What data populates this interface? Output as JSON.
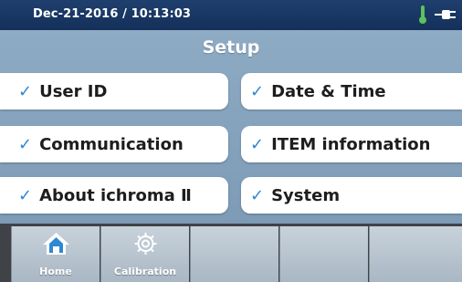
{
  "status_bar": {
    "datetime": "Dec-21-2016 / 10:13:03",
    "thermometer_color": "#5fc15a",
    "icons": [
      "thermometer-icon",
      "power-plug-icon"
    ]
  },
  "title": "Setup",
  "menu": {
    "check_mark": "✓",
    "items": [
      {
        "label": "User ID"
      },
      {
        "label": "Date & Time"
      },
      {
        "label": "Communication"
      },
      {
        "label": "ITEM information"
      },
      {
        "label": "About ichroma Ⅱ"
      },
      {
        "label": "System"
      }
    ]
  },
  "nav": {
    "tabs": [
      {
        "label": "Home",
        "icon": "home-icon"
      },
      {
        "label": "Calibration",
        "icon": "gear-icon"
      },
      {
        "label": ""
      },
      {
        "label": ""
      },
      {
        "label": ""
      }
    ]
  },
  "colors": {
    "status_bar": "#1f3f6e",
    "panel": "#8eabc4",
    "check": "#2f88d2",
    "nav_bar": "#3f4347"
  }
}
